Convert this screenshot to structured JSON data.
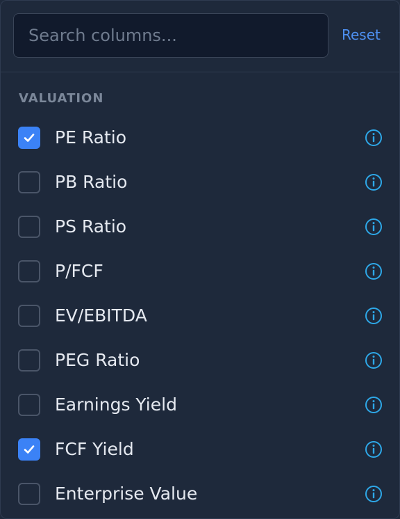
{
  "search": {
    "placeholder": "Search columns..."
  },
  "reset_label": "Reset",
  "section": {
    "title": "VALUATION"
  },
  "items": [
    {
      "label": "PE Ratio",
      "checked": true
    },
    {
      "label": "PB Ratio",
      "checked": false
    },
    {
      "label": "PS Ratio",
      "checked": false
    },
    {
      "label": "P/FCF",
      "checked": false
    },
    {
      "label": "EV/EBITDA",
      "checked": false
    },
    {
      "label": "PEG Ratio",
      "checked": false
    },
    {
      "label": "Earnings Yield",
      "checked": false
    },
    {
      "label": "FCF Yield",
      "checked": true
    },
    {
      "label": "Enterprise Value",
      "checked": false
    }
  ],
  "colors": {
    "accent": "#3b82f6",
    "info_icon": "#2ea8e8",
    "link": "#4d8ff0"
  },
  "icons": {
    "checkbox_mark": "check-icon",
    "info": "info-icon"
  }
}
